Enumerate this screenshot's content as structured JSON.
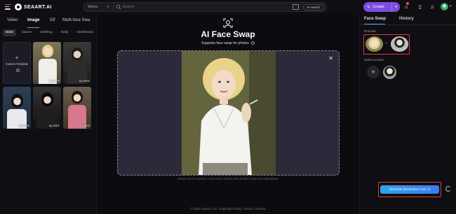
{
  "header": {
    "logo_text": "SEAART.AI",
    "search_scope": "Works",
    "search_placeholder": "Search",
    "ai_search_label": "AI search",
    "create_label": "Create"
  },
  "left_panel": {
    "tabs": [
      {
        "label": "Video"
      },
      {
        "label": "Image",
        "active": true
      },
      {
        "label": "Gif"
      },
      {
        "label": "Multi-face Swa"
      }
    ],
    "categories": [
      {
        "label": "Babe",
        "active": true
      },
      {
        "label": "Dance"
      },
      {
        "label": "Clothing"
      },
      {
        "label": "Daily"
      },
      {
        "label": "Gentleman"
      }
    ],
    "custom_template_label": "Custom Template",
    "templates": [
      {
        "author": "By:HERE"
      },
      {
        "author": "By:HERE"
      },
      {
        "author": "By:HERE"
      },
      {
        "author": "By:HERE"
      },
      {
        "author": "By:HERE"
      }
    ]
  },
  "main": {
    "title": "AI Face Swap",
    "subtitle": "Supports face swap for photos",
    "disclaimer": "Please do not upload or generate content that violates laws and regulations.",
    "footer": "© 2025 SeaArt, Inc. Copyright Policy  |  Terms  |  Privacy"
  },
  "right_panel": {
    "tabs": [
      {
        "label": "Face Swap",
        "active": true
      },
      {
        "label": "History"
      }
    ],
    "process_label": "Process",
    "select_face_label": "Select a Face",
    "generate_label": "Generate (Estimated Cost: 1)"
  },
  "colors": {
    "accent": "#4ea6ff",
    "create_button": "#7c4dde",
    "highlight_box": "#e03a3a",
    "background": "#0c0c10"
  }
}
